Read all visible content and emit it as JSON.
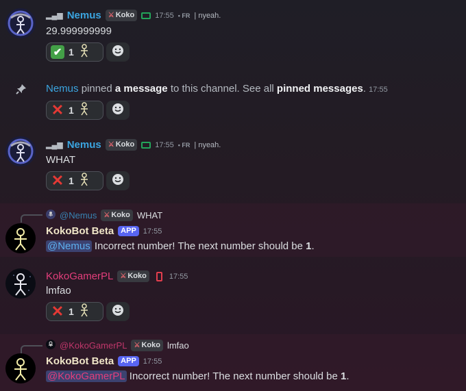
{
  "m1": {
    "user": "Nemus",
    "tag": "Koko",
    "time": "17:55",
    "lang": "• FR",
    "status": "| nyeah.",
    "text": "29.999999999",
    "reaction": {
      "count": "1",
      "emoji": "check-mark"
    }
  },
  "pin": {
    "user": "Nemus",
    "t1": "pinned",
    "t2": "a message",
    "t3": "to this channel. See all",
    "t4": "pinned messages",
    "t5": ".",
    "time": "17:55",
    "reaction": {
      "count": "1",
      "emoji": "cross-mark"
    }
  },
  "m2": {
    "user": "Nemus",
    "tag": "Koko",
    "time": "17:55",
    "lang": "• FR",
    "status": "| nyeah.",
    "text": "WHAT",
    "reaction": {
      "count": "1",
      "emoji": "cross-mark"
    }
  },
  "m3": {
    "reply_user": "@Nemus",
    "reply_tag": "Koko",
    "reply_text": "WHAT",
    "user": "KokoBot Beta",
    "badge": "APP",
    "time": "17:55",
    "mention": "@Nemus",
    "text_a": "Incorrect number! The next number should be",
    "num": "1",
    "text_b": "."
  },
  "m4": {
    "user": "KokoGamerPL",
    "tag": "Koko",
    "time": "17:55",
    "text": "lmfao",
    "reaction": {
      "count": "1",
      "emoji": "cross-mark"
    }
  },
  "m5": {
    "reply_user": "@KokoGamerPL",
    "reply_tag": "Koko",
    "reply_text": "lmfao",
    "user": "KokoBot Beta",
    "badge": "APP",
    "time": "17:55",
    "mention": "@KokoGamerPL",
    "text_a": "Incorrect number! The next number should be",
    "num": "1",
    "text_b": "."
  },
  "colors": {
    "blue_user": "#3ba5e0",
    "bot_user": "#f0e6c8",
    "pink_user": "#e33e7b",
    "app_badge": "#5865f2"
  }
}
